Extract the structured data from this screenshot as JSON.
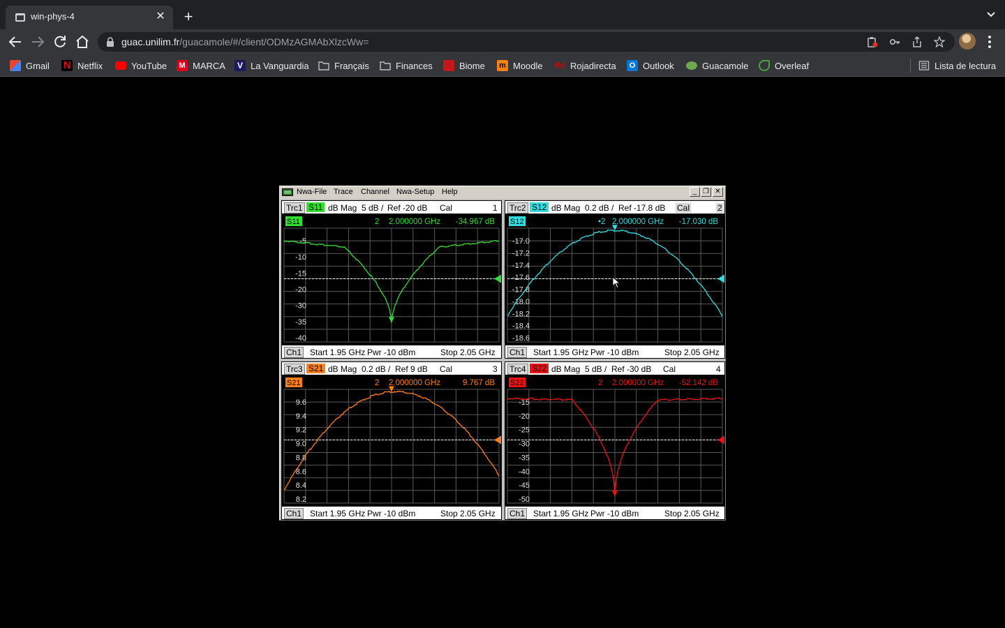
{
  "browser": {
    "tab_title": "win-phys-4",
    "tab_close": "✕",
    "new_tab": "+",
    "url_host": "guac.unilim.fr",
    "url_path": "/guacamole/#/client/ODMzAGMAbXlzcWw=",
    "bookmarks": [
      {
        "label": "Gmail",
        "icon": "gmail-icon",
        "color": "#ea4335"
      },
      {
        "label": "Netflix",
        "icon": "netflix-icon",
        "color": "#e50914"
      },
      {
        "label": "YouTube",
        "icon": "youtube-icon",
        "color": "#ff0000"
      },
      {
        "label": "MARCA",
        "icon": "marca-icon",
        "color": "#d9001b"
      },
      {
        "label": "La Vanguardia",
        "icon": "lavanguardia-icon",
        "color": "#1a1a5e"
      },
      {
        "label": "Français",
        "icon": "folder-icon",
        "color": "#9aa0a6"
      },
      {
        "label": "Finances",
        "icon": "folder-icon",
        "color": "#9aa0a6"
      },
      {
        "label": "Biome",
        "icon": "biome-icon",
        "color": "#c4161c"
      },
      {
        "label": "Moodle",
        "icon": "moodle-icon",
        "color": "#f98012"
      },
      {
        "label": "Rojadirecta",
        "icon": "rojadirecta-icon",
        "color": "#d50000"
      },
      {
        "label": "Outlook",
        "icon": "outlook-icon",
        "color": "#0078d4"
      },
      {
        "label": "Guacamole",
        "icon": "guacamole-icon",
        "color": "#6fa84f"
      },
      {
        "label": "Overleaf",
        "icon": "overleaf-icon",
        "color": "#47a141"
      }
    ],
    "reading_list": "Lista de lectura"
  },
  "vna": {
    "menu": [
      "Nwa-File",
      "Trace",
      "Channel",
      "Nwa-Setup",
      "Help"
    ],
    "win_buttons": [
      "_",
      "❐",
      "✕"
    ],
    "panels": [
      {
        "trc": "Trc1",
        "param": "S11",
        "color": "#33dd33",
        "format": "dB Mag",
        "scale": "5 dB /",
        "ref": "Ref -20 dB",
        "cal": "Cal",
        "num": "1",
        "marker_label": "S11",
        "marker_num": "2",
        "marker_freq": "2.000000 GHz",
        "marker_value": "-34.967 dB",
        "y_ticks": [
          "-5",
          "-10",
          "-15",
          "-20",
          "-30",
          "-35",
          "-40"
        ],
        "footer": {
          "ch": "Ch1",
          "start": "Start  1.95 GHz",
          "pwr": "Pwr -10 dBm",
          "stop": "Stop  2.05 GHz"
        }
      },
      {
        "trc": "Trc2",
        "param": "S12",
        "color": "#33dddd",
        "format": "dB Mag",
        "scale": "0.2 dB /",
        "ref": "Ref -17.8 dB",
        "cal": "Cal",
        "num": "2",
        "marker_label": "S12",
        "marker_num": "•2",
        "marker_freq": "2.000000 GHz",
        "marker_value": "-17.030 dB",
        "y_ticks": [
          "-17.0",
          "-17.2",
          "-17.4",
          "-17.6",
          "-17.8",
          "-18.0",
          "-18.2",
          "-18.4",
          "-18.6"
        ],
        "footer": {
          "ch": "Ch1",
          "start": "Start  1.95 GHz",
          "pwr": "Pwr -10 dBm",
          "stop": "Stop  2.05 GHz"
        }
      },
      {
        "trc": "Trc3",
        "param": "S21",
        "color": "#ff7f1a",
        "format": "dB Mag",
        "scale": "0.2 dB /",
        "ref": "Ref 9 dB",
        "cal": "Cal",
        "num": "3",
        "marker_label": "S21",
        "marker_num": "2",
        "marker_freq": "2.000000 GHz",
        "marker_value": "9.767 dB",
        "y_ticks": [
          "9.6",
          "9.4",
          "9.2",
          "9.0",
          "8.8",
          "8.6",
          "8.4",
          "8.2"
        ],
        "footer": {
          "ch": "Ch1",
          "start": "Start  1.95 GHz",
          "pwr": "Pwr -10 dBm",
          "stop": "Stop  2.05 GHz"
        }
      },
      {
        "trc": "Trc4",
        "param": "S22",
        "color": "#ee1111",
        "format": "dB Mag",
        "scale": "5 dB /",
        "ref": "Ref -30 dB",
        "cal": "Cal",
        "num": "4",
        "marker_label": "S22",
        "marker_num": "2",
        "marker_freq": "2.000000 GHz",
        "marker_value": "-52.142 dB",
        "y_ticks": [
          "-15",
          "-20",
          "-25",
          "-30",
          "-35",
          "-40",
          "-45",
          "-50"
        ],
        "footer": {
          "ch": "Ch1",
          "start": "Start  1.95 GHz",
          "pwr": "Pwr -10 dBm",
          "stop": "Stop  2.05 GHz"
        }
      }
    ]
  }
}
